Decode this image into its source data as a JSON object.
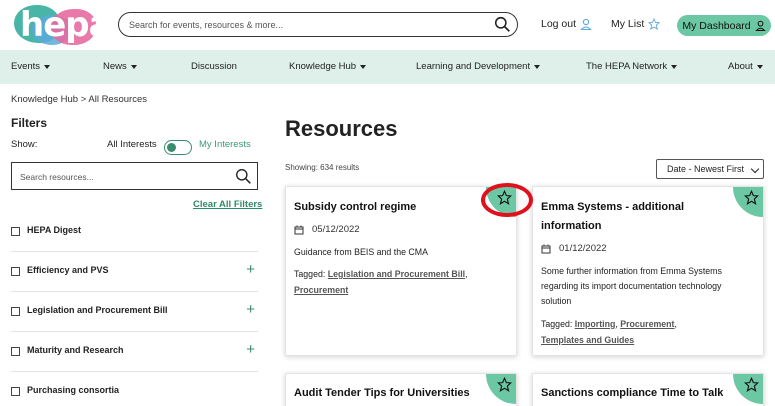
{
  "header": {
    "logo_text": "hepa",
    "search_placeholder": "Search for events, resources & more...",
    "logout_label": "Log out",
    "mylist_label": "My List",
    "dashboard_label": "My Dashboard"
  },
  "nav": {
    "items": [
      {
        "label": "Events",
        "has_menu": true
      },
      {
        "label": "News",
        "has_menu": true
      },
      {
        "label": "Discussion",
        "has_menu": false
      },
      {
        "label": "Knowledge Hub",
        "has_menu": true
      },
      {
        "label": "Learning and Development",
        "has_menu": true
      },
      {
        "label": "The HEPA Network",
        "has_menu": true
      },
      {
        "label": "About",
        "has_menu": true
      }
    ]
  },
  "breadcrumb": "Knowledge Hub > All Resources",
  "filters": {
    "title": "Filters",
    "show_label": "Show:",
    "all_interests": "All Interests",
    "my_interests": "My Interests",
    "search_placeholder": "Search resources...",
    "clear_all": "Clear All Filters",
    "items": [
      {
        "label": "HEPA Digest",
        "expandable": false
      },
      {
        "label": "Efficiency and PVS",
        "expandable": true
      },
      {
        "label": "Legislation and Procurement Bill",
        "expandable": true
      },
      {
        "label": "Maturity and Research",
        "expandable": true
      },
      {
        "label": "Purchasing consortia",
        "expandable": false
      }
    ]
  },
  "main": {
    "title": "Resources",
    "showing": "Showing: 634 results",
    "sort_value": "Date - Newest First"
  },
  "cards": [
    {
      "title_lines": [
        "Subsidy control regime"
      ],
      "date": "05/12/2022",
      "desc_lines": [
        "Guidance from BEIS and the CMA"
      ],
      "tagged_label": "Tagged:",
      "tags": [
        "Legislation and Procurement Bill",
        "Procurement"
      ]
    },
    {
      "title_lines": [
        "Emma Systems - additional",
        "information"
      ],
      "date": "01/12/2022",
      "desc_lines": [
        "Some further information from Emma Systems",
        "regarding its import documentation technology",
        "solution"
      ],
      "tagged_label": "Tagged:",
      "tags": [
        "Importing",
        "Procurement",
        "Templates and Guides"
      ]
    },
    {
      "title_lines": [
        "Audit Tender Tips for Universities"
      ]
    },
    {
      "title_lines": [
        "Sanctions compliance Time to Talk"
      ]
    }
  ],
  "colors": {
    "accent_green": "#6cc7a4",
    "nav_bg": "#dff0ea",
    "highlight_red": "#e0101c",
    "link_green": "#2e8b68"
  }
}
